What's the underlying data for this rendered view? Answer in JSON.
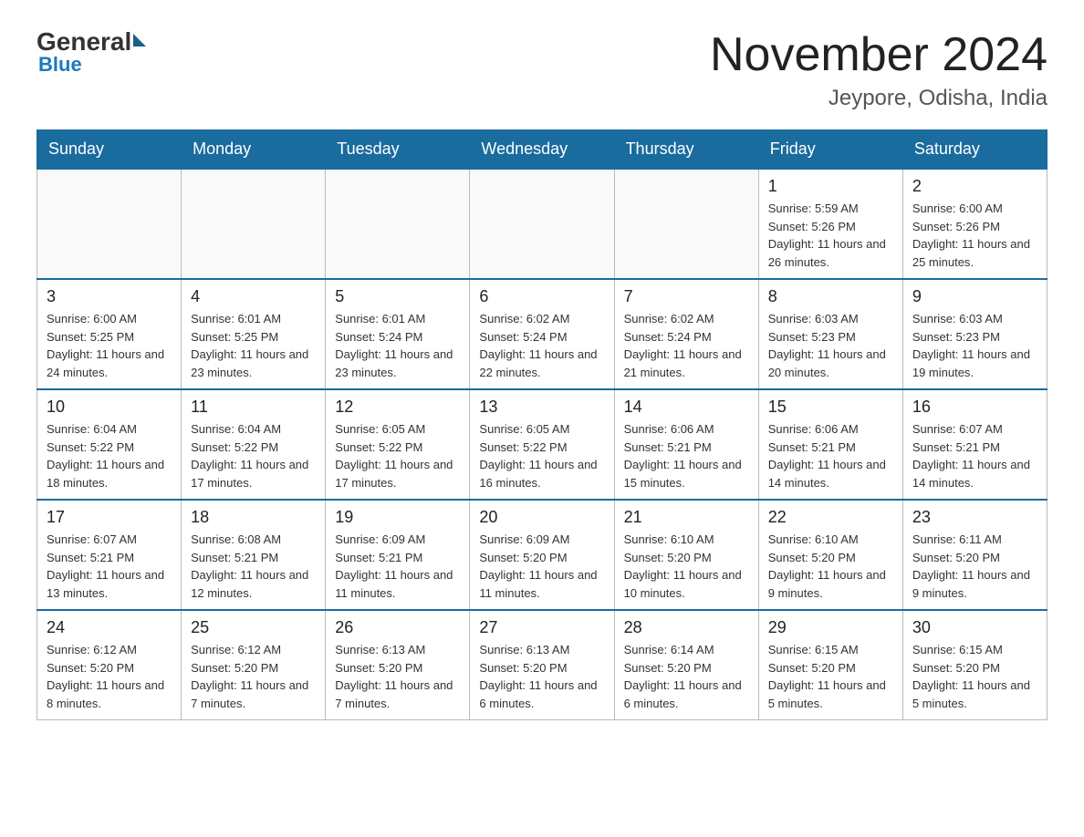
{
  "header": {
    "logo_general": "General",
    "logo_blue": "Blue",
    "month_title": "November 2024",
    "location": "Jeypore, Odisha, India"
  },
  "columns": [
    "Sunday",
    "Monday",
    "Tuesday",
    "Wednesday",
    "Thursday",
    "Friday",
    "Saturday"
  ],
  "weeks": [
    [
      {
        "day": "",
        "info": ""
      },
      {
        "day": "",
        "info": ""
      },
      {
        "day": "",
        "info": ""
      },
      {
        "day": "",
        "info": ""
      },
      {
        "day": "",
        "info": ""
      },
      {
        "day": "1",
        "info": "Sunrise: 5:59 AM\nSunset: 5:26 PM\nDaylight: 11 hours and 26 minutes."
      },
      {
        "day": "2",
        "info": "Sunrise: 6:00 AM\nSunset: 5:26 PM\nDaylight: 11 hours and 25 minutes."
      }
    ],
    [
      {
        "day": "3",
        "info": "Sunrise: 6:00 AM\nSunset: 5:25 PM\nDaylight: 11 hours and 24 minutes."
      },
      {
        "day": "4",
        "info": "Sunrise: 6:01 AM\nSunset: 5:25 PM\nDaylight: 11 hours and 23 minutes."
      },
      {
        "day": "5",
        "info": "Sunrise: 6:01 AM\nSunset: 5:24 PM\nDaylight: 11 hours and 23 minutes."
      },
      {
        "day": "6",
        "info": "Sunrise: 6:02 AM\nSunset: 5:24 PM\nDaylight: 11 hours and 22 minutes."
      },
      {
        "day": "7",
        "info": "Sunrise: 6:02 AM\nSunset: 5:24 PM\nDaylight: 11 hours and 21 minutes."
      },
      {
        "day": "8",
        "info": "Sunrise: 6:03 AM\nSunset: 5:23 PM\nDaylight: 11 hours and 20 minutes."
      },
      {
        "day": "9",
        "info": "Sunrise: 6:03 AM\nSunset: 5:23 PM\nDaylight: 11 hours and 19 minutes."
      }
    ],
    [
      {
        "day": "10",
        "info": "Sunrise: 6:04 AM\nSunset: 5:22 PM\nDaylight: 11 hours and 18 minutes."
      },
      {
        "day": "11",
        "info": "Sunrise: 6:04 AM\nSunset: 5:22 PM\nDaylight: 11 hours and 17 minutes."
      },
      {
        "day": "12",
        "info": "Sunrise: 6:05 AM\nSunset: 5:22 PM\nDaylight: 11 hours and 17 minutes."
      },
      {
        "day": "13",
        "info": "Sunrise: 6:05 AM\nSunset: 5:22 PM\nDaylight: 11 hours and 16 minutes."
      },
      {
        "day": "14",
        "info": "Sunrise: 6:06 AM\nSunset: 5:21 PM\nDaylight: 11 hours and 15 minutes."
      },
      {
        "day": "15",
        "info": "Sunrise: 6:06 AM\nSunset: 5:21 PM\nDaylight: 11 hours and 14 minutes."
      },
      {
        "day": "16",
        "info": "Sunrise: 6:07 AM\nSunset: 5:21 PM\nDaylight: 11 hours and 14 minutes."
      }
    ],
    [
      {
        "day": "17",
        "info": "Sunrise: 6:07 AM\nSunset: 5:21 PM\nDaylight: 11 hours and 13 minutes."
      },
      {
        "day": "18",
        "info": "Sunrise: 6:08 AM\nSunset: 5:21 PM\nDaylight: 11 hours and 12 minutes."
      },
      {
        "day": "19",
        "info": "Sunrise: 6:09 AM\nSunset: 5:21 PM\nDaylight: 11 hours and 11 minutes."
      },
      {
        "day": "20",
        "info": "Sunrise: 6:09 AM\nSunset: 5:20 PM\nDaylight: 11 hours and 11 minutes."
      },
      {
        "day": "21",
        "info": "Sunrise: 6:10 AM\nSunset: 5:20 PM\nDaylight: 11 hours and 10 minutes."
      },
      {
        "day": "22",
        "info": "Sunrise: 6:10 AM\nSunset: 5:20 PM\nDaylight: 11 hours and 9 minutes."
      },
      {
        "day": "23",
        "info": "Sunrise: 6:11 AM\nSunset: 5:20 PM\nDaylight: 11 hours and 9 minutes."
      }
    ],
    [
      {
        "day": "24",
        "info": "Sunrise: 6:12 AM\nSunset: 5:20 PM\nDaylight: 11 hours and 8 minutes."
      },
      {
        "day": "25",
        "info": "Sunrise: 6:12 AM\nSunset: 5:20 PM\nDaylight: 11 hours and 7 minutes."
      },
      {
        "day": "26",
        "info": "Sunrise: 6:13 AM\nSunset: 5:20 PM\nDaylight: 11 hours and 7 minutes."
      },
      {
        "day": "27",
        "info": "Sunrise: 6:13 AM\nSunset: 5:20 PM\nDaylight: 11 hours and 6 minutes."
      },
      {
        "day": "28",
        "info": "Sunrise: 6:14 AM\nSunset: 5:20 PM\nDaylight: 11 hours and 6 minutes."
      },
      {
        "day": "29",
        "info": "Sunrise: 6:15 AM\nSunset: 5:20 PM\nDaylight: 11 hours and 5 minutes."
      },
      {
        "day": "30",
        "info": "Sunrise: 6:15 AM\nSunset: 5:20 PM\nDaylight: 11 hours and 5 minutes."
      }
    ]
  ]
}
